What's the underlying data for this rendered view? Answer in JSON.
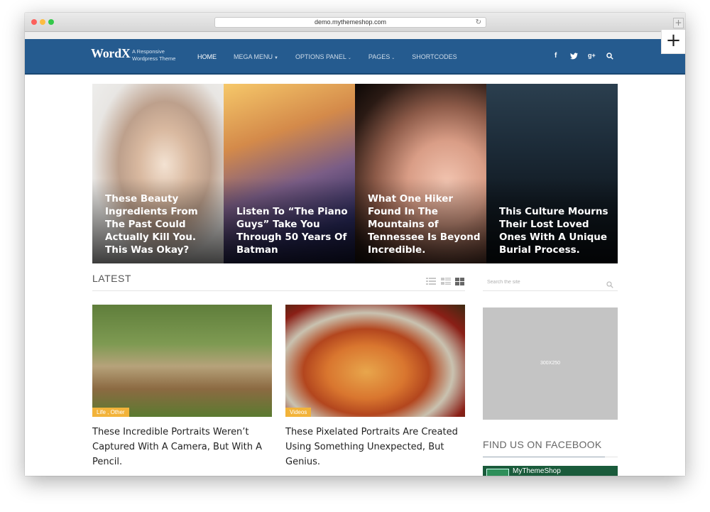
{
  "browser": {
    "url": "demo.mythemeshop.com"
  },
  "header": {
    "logo": "WordX",
    "tagline": "A Responsive Wordpress Theme",
    "nav": [
      {
        "label": "HOME",
        "active": true,
        "dropdown": false
      },
      {
        "label": "MEGA MENU",
        "active": false,
        "dropdown": true
      },
      {
        "label": "OPTIONS PANEL",
        "active": false,
        "dropdown": true
      },
      {
        "label": "PAGES",
        "active": false,
        "dropdown": true
      },
      {
        "label": "SHORTCODES",
        "active": false,
        "dropdown": false
      }
    ],
    "social": [
      "f",
      "twitter-icon",
      "g+",
      "search-icon"
    ],
    "social_labels": {
      "facebook": "f",
      "google": "g+"
    },
    "plus_symbol": "+"
  },
  "slider": [
    {
      "title": "These Beauty Ingredients From The Past Could Actually Kill You. This Was Okay?"
    },
    {
      "title": "Listen To “The Piano Guys” Take You Through 50 Years Of Batman"
    },
    {
      "title": "What One Hiker Found In The Mountains of Tennessee Is Beyond Incredible."
    },
    {
      "title": "This Culture Mourns Their Lost Loved Ones With A Unique Burial Process."
    }
  ],
  "latest": {
    "heading": "LATEST",
    "view_modes": [
      "list-view-icon",
      "compact-view-icon",
      "grid-view-icon"
    ]
  },
  "posts": [
    {
      "category": "Life , Other",
      "title": "These Incredible Portraits Weren’t Captured With A Camera, But With A Pencil."
    },
    {
      "category": "Videos",
      "title": "These Pixelated Portraits Are Created Using Something Unexpected, But Genius."
    }
  ],
  "sidebar": {
    "search_placeholder": "Search the site",
    "ad_label": "300X250",
    "facebook_heading": "FIND US ON FACEBOOK",
    "facebook_page": "MyThemeShop"
  },
  "colors": {
    "header": "#255b8f",
    "badge": "#f2b33a",
    "ad": "#c4c4c4"
  }
}
